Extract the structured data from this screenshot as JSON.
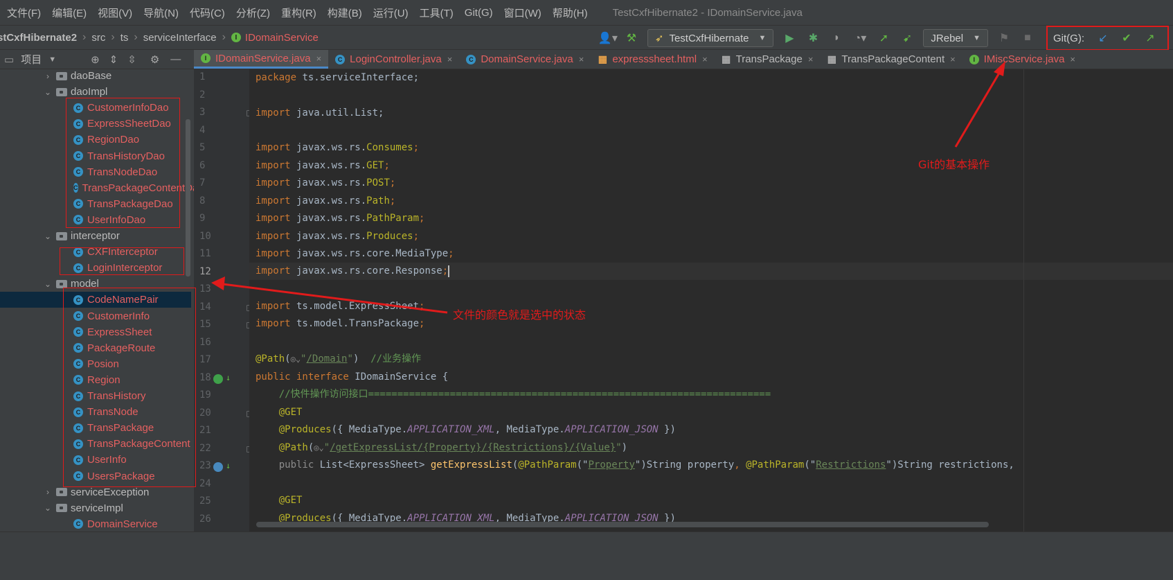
{
  "menu": {
    "items": [
      "文件(F)",
      "编辑(E)",
      "视图(V)",
      "导航(N)",
      "代码(C)",
      "分析(Z)",
      "重构(R)",
      "构建(B)",
      "运行(U)",
      "工具(T)",
      "Git(G)",
      "窗口(W)",
      "帮助(H)"
    ],
    "window_title": "TestCxfHibernate2 - IDomainService.java"
  },
  "breadcrumb": {
    "project": "stCxfHibernate2",
    "src": "src",
    "ts": "ts",
    "package": "serviceInterface",
    "file": "IDomainService",
    "file_badge": "I"
  },
  "toolbar": {
    "run_config": "TestCxfHibernate",
    "jrebel": "JRebel",
    "git_label": "Git(G):"
  },
  "project_panel": {
    "title": "项目",
    "tree": [
      {
        "label": "daoBase",
        "type": "folder",
        "expanded": false
      },
      {
        "label": "daoImpl",
        "type": "folder",
        "expanded": true
      },
      {
        "label": "CustomerInfoDao",
        "type": "class"
      },
      {
        "label": "ExpressSheetDao",
        "type": "class"
      },
      {
        "label": "RegionDao",
        "type": "class"
      },
      {
        "label": "TransHistoryDao",
        "type": "class"
      },
      {
        "label": "TransNodeDao",
        "type": "class"
      },
      {
        "label": "TransPackageContentDao",
        "type": "class"
      },
      {
        "label": "TransPackageDao",
        "type": "class"
      },
      {
        "label": "UserInfoDao",
        "type": "class"
      },
      {
        "label": "interceptor",
        "type": "folder",
        "expanded": true
      },
      {
        "label": "CXFInterceptor",
        "type": "class"
      },
      {
        "label": "LoginInterceptor",
        "type": "class"
      },
      {
        "label": "model",
        "type": "folder",
        "expanded": true
      },
      {
        "label": "CodeNamePair",
        "type": "class",
        "selected": true
      },
      {
        "label": "CustomerInfo",
        "type": "class"
      },
      {
        "label": "ExpressSheet",
        "type": "class"
      },
      {
        "label": "PackageRoute",
        "type": "class"
      },
      {
        "label": "Posion",
        "type": "class"
      },
      {
        "label": "Region",
        "type": "class"
      },
      {
        "label": "TransHistory",
        "type": "class"
      },
      {
        "label": "TransNode",
        "type": "class"
      },
      {
        "label": "TransPackage",
        "type": "class"
      },
      {
        "label": "TransPackageContent",
        "type": "class"
      },
      {
        "label": "UserInfo",
        "type": "class"
      },
      {
        "label": "UsersPackage",
        "type": "class"
      },
      {
        "label": "serviceException",
        "type": "folder",
        "expanded": false
      },
      {
        "label": "serviceImpl",
        "type": "folder",
        "expanded": true
      },
      {
        "label": "DomainService",
        "type": "class"
      }
    ],
    "class_badge": "C"
  },
  "tabs": [
    {
      "label": "IDomainService.java",
      "icon": "interface-icon",
      "badge": "I",
      "active": true
    },
    {
      "label": "LoginController.java",
      "icon": "class-icon",
      "badge": "C"
    },
    {
      "label": "DomainService.java",
      "icon": "class-icon",
      "badge": "C"
    },
    {
      "label": "expresssheet.html",
      "icon": "html-icon",
      "badge": "▦"
    },
    {
      "label": "TransPackage",
      "icon": "table-icon",
      "badge": "▦",
      "plain": true
    },
    {
      "label": "TransPackageContent",
      "icon": "table-icon",
      "badge": "▦",
      "plain": true
    },
    {
      "label": "IMiscService.java",
      "icon": "interface-icon",
      "badge": "I"
    }
  ],
  "editor": {
    "current_line": 12,
    "line_count": 26,
    "code": {
      "l1_kw": "package",
      "l1_rest": " ts.serviceInterface;",
      "l3_kw": "import",
      "l3_rest": " java.util.List;",
      "l5_kw": "import",
      "l5_pkg": " javax.ws.rs.",
      "l5_cls": "Consumes",
      "l5_end": ";",
      "l6_kw": "import",
      "l6_pkg": " javax.ws.rs.",
      "l6_cls": "GET",
      "l6_end": ";",
      "l7_kw": "import",
      "l7_pkg": " javax.ws.rs.",
      "l7_cls": "POST",
      "l7_end": ";",
      "l8_kw": "import",
      "l8_pkg": " javax.ws.rs.",
      "l8_cls": "Path",
      "l8_end": ";",
      "l9_kw": "import",
      "l9_pkg": " javax.ws.rs.",
      "l9_cls": "PathParam",
      "l9_end": ";",
      "l10_kw": "import",
      "l10_pkg": " javax.ws.rs.",
      "l10_cls": "Produces",
      "l10_end": ";",
      "l11_kw": "import",
      "l11_rest": " javax.ws.rs.core.MediaType",
      "l11_end": ";",
      "l12_kw": "import",
      "l12_rest": " javax.ws.rs.core.Response",
      "l12_end": ";",
      "l14_kw": "import",
      "l14_rest": " ts.model.ExpressSheet",
      "l14_end": ";",
      "l15_kw": "import",
      "l15_rest": " ts.model.TransPackage",
      "l15_end": ";",
      "l17_ann": "@Path",
      "l17_open": "(",
      "l17_q1": "\"",
      "l17_str": "/Domain",
      "l17_q2": "\"",
      "l17_close": ")  ",
      "l17_cmt": "//业务操作",
      "l18_kw": "public interface",
      "l18_rest": " IDomainService {",
      "l19_cmt": "    //快件操作访问接口=====================================================================",
      "l20_ann": "    @GET",
      "l21_ann": "    @Produces",
      "l21_a": "({ MediaType.",
      "l21_c1": "APPLICATION_XML",
      "l21_b": ", MediaType.",
      "l21_c2": "APPLICATION_JSON",
      "l21_end": " })",
      "l22_ann": "    @Path",
      "l22_open": "(",
      "l22_q1": "\"",
      "l22_str": "/getExpressList/{Property}/{Restrictions}/{Value}",
      "l22_q2": "\"",
      "l22_close": ")",
      "l23_kw": "    public",
      "l23_a": " List<ExpressSheet> ",
      "l23_fn": "getExpressList",
      "l23_b": "(",
      "l23_ann1": "@PathParam",
      "l23_c": "(\"",
      "l23_s1": "Property",
      "l23_d": "\")String property",
      "l23_comma": ", ",
      "l23_ann2": "@PathParam",
      "l23_e": "(\"",
      "l23_s2": "Restrictions",
      "l23_f": "\")String restrictions,",
      "l25_ann": "    @GET",
      "l26_ann": "    @Produces",
      "l26_a": "({ MediaType.",
      "l26_c1": "APPLICATION_XML",
      "l26_b": ", MediaType.",
      "l26_c2": "APPLICATION_JSON",
      "l26_end": " })"
    }
  },
  "annotations": {
    "git_note": "Git的基本操作",
    "color_note": "文件的颜色就是选中的状态"
  },
  "colors": {
    "modified_file": "#e46060",
    "annotation_red": "#e11b1b",
    "selection": "#0d293e"
  }
}
